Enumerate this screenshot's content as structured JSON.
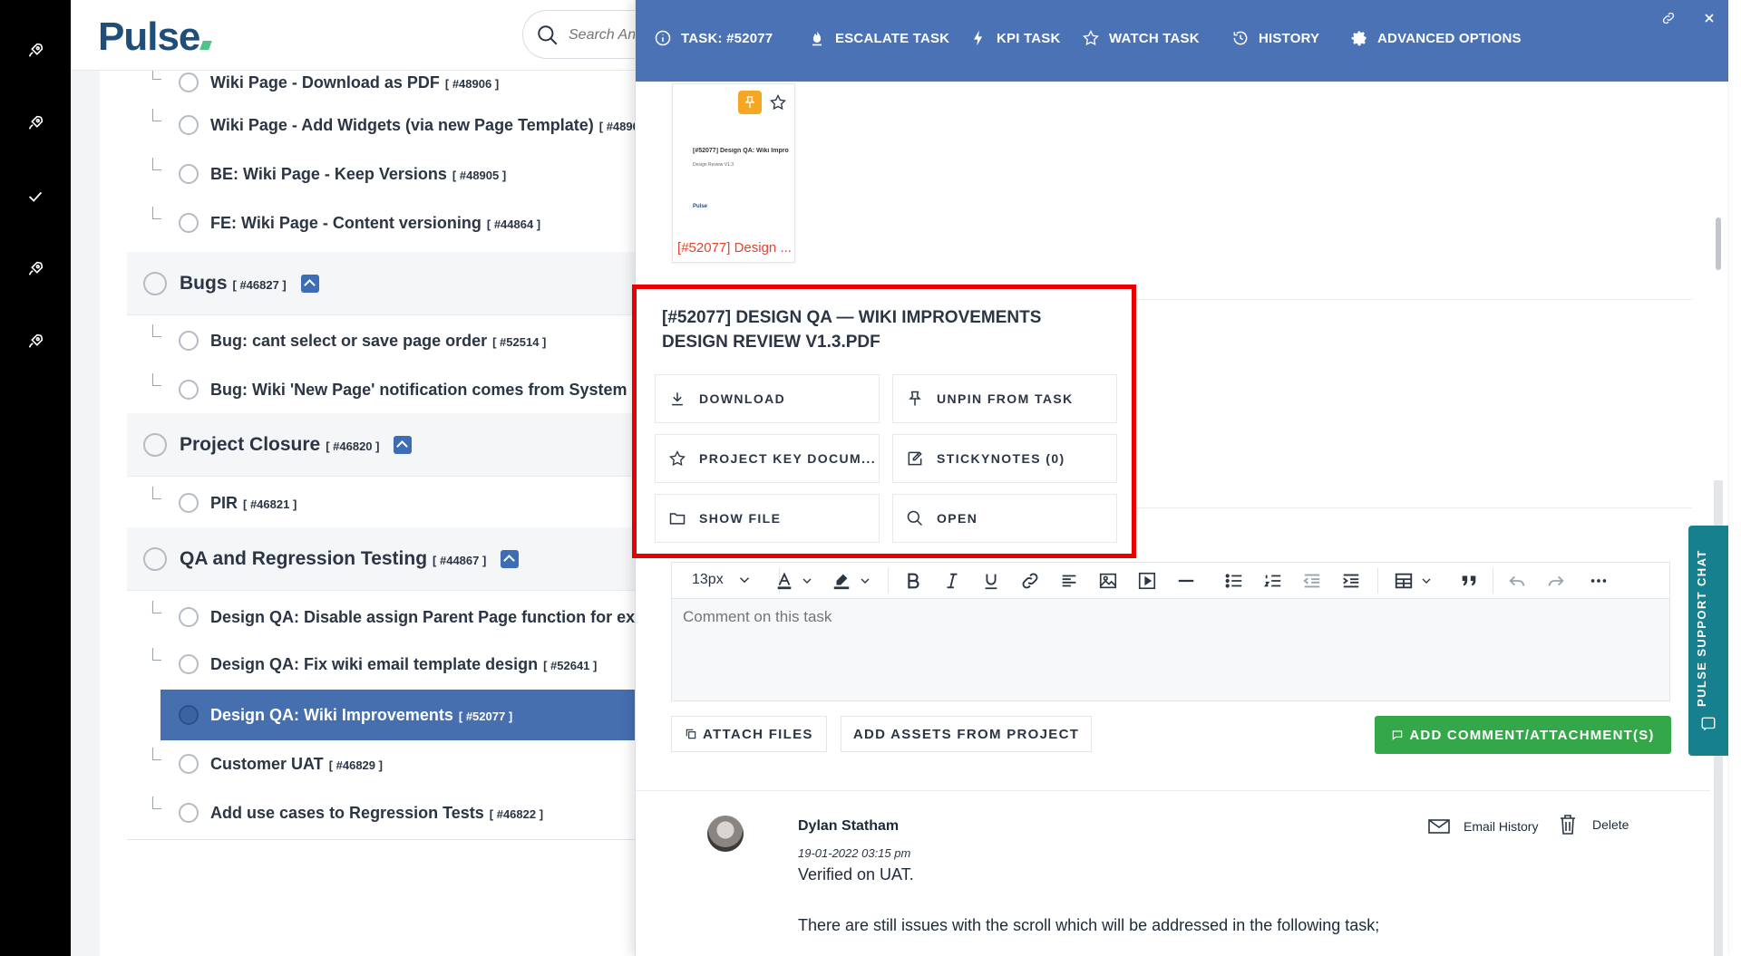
{
  "app": {
    "logo": "Pulse"
  },
  "search": {
    "placeholder": "Search Any"
  },
  "list": {
    "rows": [
      {
        "label": "Wiki Page - Download as PDF",
        "ref": "[ #48906 ]"
      },
      {
        "label": "Wiki Page - Add Widgets (via new Page Template)",
        "ref": "[ #4890"
      },
      {
        "label": "BE: Wiki Page - Keep Versions",
        "ref": "[ #48905 ]"
      },
      {
        "label": "FE: Wiki Page - Content versioning",
        "ref": "[ #44864 ]"
      },
      {
        "label": "Bugs",
        "ref": "[ #46827 ]"
      },
      {
        "label": "Bug: cant select or save page order",
        "ref": "[ #52514 ]"
      },
      {
        "label": "Bug: Wiki 'New Page' notification comes from System - ",
        "ref": ""
      },
      {
        "label": "Project Closure",
        "ref": "[ #46820 ]"
      },
      {
        "label": "PIR",
        "ref": "[ #46821 ]"
      },
      {
        "label": "QA and Regression Testing",
        "ref": "[ #44867 ]"
      },
      {
        "label": "Design QA: Disable assign Parent Page function for exis",
        "ref": ""
      },
      {
        "label": "Design QA: Fix wiki email template design",
        "ref": "[ #52641 ]"
      },
      {
        "label": "Design QA: Wiki Improvements",
        "ref": "[ #52077 ]"
      },
      {
        "label": "Customer UAT",
        "ref": "[ #46829 ]"
      },
      {
        "label": "Add use cases to Regression Tests",
        "ref": "[ #46822 ]"
      }
    ]
  },
  "header": {
    "task": "TASK: #52077",
    "escalate": "ESCALATE TASK",
    "kpi": "KPI TASK",
    "watch": "WATCH TASK",
    "history": "HISTORY",
    "advanced": "ADVANCED OPTIONS"
  },
  "thumbnail": {
    "doc_title": "[#52077] Design QA: Wiki Impro",
    "doc_sub": "Design Review V1.3",
    "doc_brand": "Pulse",
    "name": "[#52077] Design ..."
  },
  "popup": {
    "title": "[#52077] DESIGN QA — WIKI IMPROVEMENTS DESIGN REVIEW V1.3.PDF",
    "download": "DOWNLOAD",
    "unpin": "UNPIN FROM TASK",
    "key_doc": "PROJECT KEY DOCUM...",
    "stickynotes": "STICKYNOTES (0)",
    "show_file": "SHOW FILE",
    "open": "OPEN"
  },
  "editor": {
    "font_size": "13px",
    "placeholder": "Comment on this task"
  },
  "actions": {
    "attach": "ATTACH FILES",
    "assets": "ADD ASSETS FROM PROJECT",
    "add": "ADD COMMENT/ATTACHMENT(S)"
  },
  "comment": {
    "author": "Dylan Statham",
    "date": "19-01-2022 03:15 pm",
    "body1": "Verified on UAT.",
    "body2": "There are still issues with the scroll which will be addressed in the following task;",
    "email_history": "Email History",
    "delete": "Delete"
  },
  "support": {
    "label": "PULSE SUPPORT CHAT"
  },
  "colors": {
    "header": "#4a72b4",
    "selected": "#466fb0",
    "add_button": "#34a849",
    "popup_border": "#e60000",
    "support": "#16808f"
  }
}
